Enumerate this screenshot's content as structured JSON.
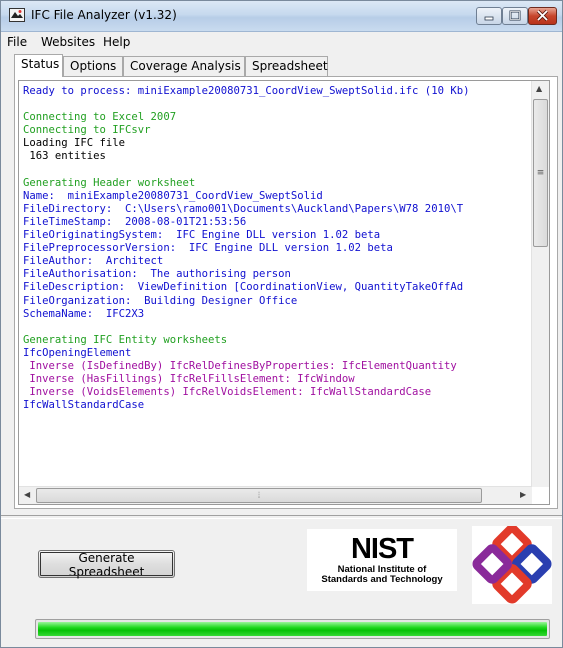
{
  "window": {
    "title": "IFC File Analyzer  (v1.32)"
  },
  "menu": {
    "items": [
      "File",
      "Websites",
      "Help"
    ]
  },
  "tabs": [
    "Status",
    "Options",
    "Coverage Analysis",
    "Spreadsheet"
  ],
  "active_tab": "Status",
  "log_lines": [
    {
      "text": "Ready to process: miniExample20080731_CoordView_SweptSolid.ifc (10 Kb)",
      "color": "blue"
    },
    {
      "text": "",
      "color": "black"
    },
    {
      "text": "Connecting to Excel 2007",
      "color": "green"
    },
    {
      "text": "Connecting to IFCsvr",
      "color": "green"
    },
    {
      "text": "Loading IFC file",
      "color": "black"
    },
    {
      "text": " 163 entities",
      "color": "black"
    },
    {
      "text": "",
      "color": "black"
    },
    {
      "text": "Generating Header worksheet",
      "color": "green"
    },
    {
      "text": "Name:  miniExample20080731_CoordView_SweptSolid",
      "color": "blue"
    },
    {
      "text": "FileDirectory:  C:\\Users\\ramo001\\Documents\\Auckland\\Papers\\W78 2010\\T",
      "color": "blue"
    },
    {
      "text": "FileTimeStamp:  2008-08-01T21:53:56",
      "color": "blue"
    },
    {
      "text": "FileOriginatingSystem:  IFC Engine DLL version 1.02 beta",
      "color": "blue"
    },
    {
      "text": "FilePreprocessorVersion:  IFC Engine DLL version 1.02 beta",
      "color": "blue"
    },
    {
      "text": "FileAuthor:  Architect",
      "color": "blue"
    },
    {
      "text": "FileAuthorisation:  The authorising person",
      "color": "blue"
    },
    {
      "text": "FileDescription:  ViewDefinition [CoordinationView, QuantityTakeOffAd",
      "color": "blue"
    },
    {
      "text": "FileOrganization:  Building Designer Office",
      "color": "blue"
    },
    {
      "text": "SchemaName:  IFC2X3",
      "color": "blue"
    },
    {
      "text": "",
      "color": "black"
    },
    {
      "text": "Generating IFC Entity worksheets",
      "color": "green"
    },
    {
      "text": "IfcOpeningElement",
      "color": "blue"
    },
    {
      "text": " Inverse (IsDefinedBy) IfcRelDefinesByProperties: IfcElementQuantity",
      "color": "purple"
    },
    {
      "text": " Inverse (HasFillings) IfcRelFillsElement: IfcWindow",
      "color": "purple"
    },
    {
      "text": " Inverse (VoidsElements) IfcRelVoidsElement: IfcWallStandardCase",
      "color": "purple"
    },
    {
      "text": "IfcWallStandardCase",
      "color": "blue"
    }
  ],
  "colors": {
    "blue": "#1010d0",
    "green": "#22a022",
    "black": "#000000",
    "purple": "#a010a0"
  },
  "buttons": {
    "generate": "Generate Spreadsheet"
  },
  "nist_logo": {
    "mark": "NIST",
    "line1": "National Institute of",
    "line2": "Standards and Technology"
  },
  "progress": {
    "fraction": 1.0
  },
  "icons": {
    "app": "app-icon",
    "minimize": "minimize-icon",
    "maximize": "maximize-icon",
    "close": "close-icon"
  }
}
